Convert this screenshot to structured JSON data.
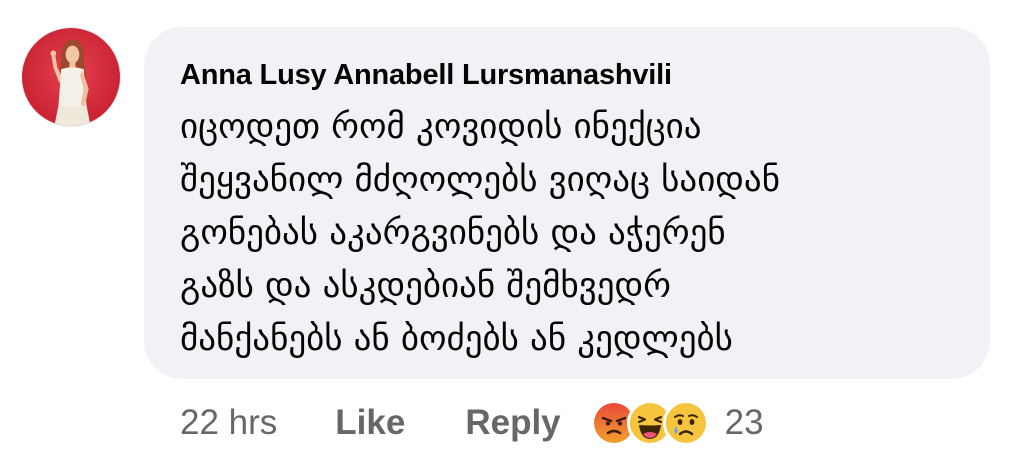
{
  "comment": {
    "author": "Anna Lusy Annabell Lursmanashvili",
    "text_lines": [
      "იცოდეთ რომ კოვიდის ინექცია",
      "შეყვანილ მძღოლებს ვიღაც საიდან",
      "გონებას აკარგვინებს და აჭერენ",
      "გაზს და ასკდებიან შემხვედრ",
      "მანქანებს ან ბოძებს ან კედლებს"
    ],
    "timestamp": "22 hrs",
    "like_label": "Like",
    "reply_label": "Reply",
    "reaction_count": "23",
    "reactions": [
      "angry-reaction-icon",
      "haha-reaction-icon",
      "sad-reaction-icon"
    ]
  },
  "colors": {
    "bubble_bg": "#f0f2f5",
    "text": "#050505",
    "meta": "#65676b",
    "avatar_bg": "#d6283a"
  }
}
